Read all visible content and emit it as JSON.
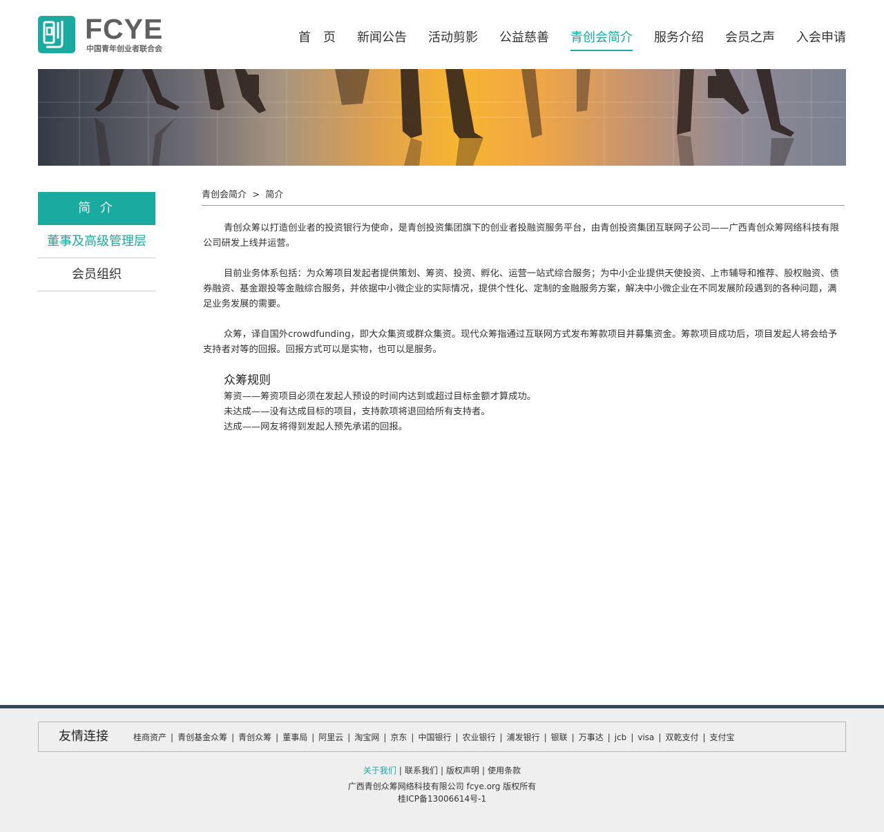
{
  "header": {
    "logo_word": "FCYE",
    "logo_sub": "中国青年创业者联合会",
    "nav": [
      {
        "label": "首　页"
      },
      {
        "label": "新闻公告"
      },
      {
        "label": "活动剪影"
      },
      {
        "label": "公益慈善"
      },
      {
        "label": "青创会简介",
        "active": true
      },
      {
        "label": "服务介绍"
      },
      {
        "label": "会员之声"
      },
      {
        "label": "入会申请"
      }
    ]
  },
  "sidebar": {
    "items": [
      {
        "label": "简 介"
      },
      {
        "label": "董事及高级管理层"
      },
      {
        "label": "会员组织"
      }
    ]
  },
  "breadcrumb": {
    "parent": "青创会简介",
    "separator": ">",
    "current": "简介"
  },
  "content": {
    "paragraphs": [
      "青创众筹以打造创业者的投资银行为使命，是青创投资集团旗下的创业者投融资服务平台，由青创投资集团互联网子公司——广西青创众筹网络科技有限公司研发上线并运营。",
      "目前业务体系包括：为众筹项目发起者提供策划、筹资、投资、孵化、运营一站式综合服务；为中小企业提供天使投资、上市辅导和推荐、股权融资、债券融资、基金跟投等金融综合服务，并依据中小微企业的实际情况，提供个性化、定制的金融服务方案，解决中小微企业在不同发展阶段遇到的各种问题，满足业务发展的需要。",
      "众筹，译自国外crowdfunding，即大众集资或群众集资。现代众筹指通过互联网方式发布筹款项目并募集资金。筹款项目成功后，项目发起人将会给予支持者对等的回报。回报方式可以是实物，也可以是服务。"
    ],
    "rules_title": "众筹规则",
    "rules": [
      "筹资——筹资项目必须在发起人预设的时间内达到或超过目标金额才算成功。",
      "未达成——没有达成目标的项目，支持款项将退回给所有支持者。",
      "达成——网友将得到发起人预先承诺的回报。"
    ]
  },
  "footer": {
    "friend_links_title": "友情连接",
    "friend_links": [
      "桂商资产",
      "青创基金众筹",
      "青创众筹",
      "董事局",
      "阿里云",
      "淘宝网",
      "京东",
      "中国银行",
      "农业银行",
      "浦发银行",
      "银联",
      "万事达",
      "jcb",
      "visa",
      "双乾支付",
      "支付宝"
    ],
    "nav": [
      "关于我们",
      "联系我们",
      "版权声明",
      "使用条款"
    ],
    "nav_separator": "|",
    "company": "广西青创众筹网络科技有限公司 fcye.org 版权所有",
    "icp": "桂ICP备13006614号-1"
  },
  "colors": {
    "accent": "#1aaa9f",
    "footer_border": "#34495a",
    "footer_bg": "#efefef"
  }
}
